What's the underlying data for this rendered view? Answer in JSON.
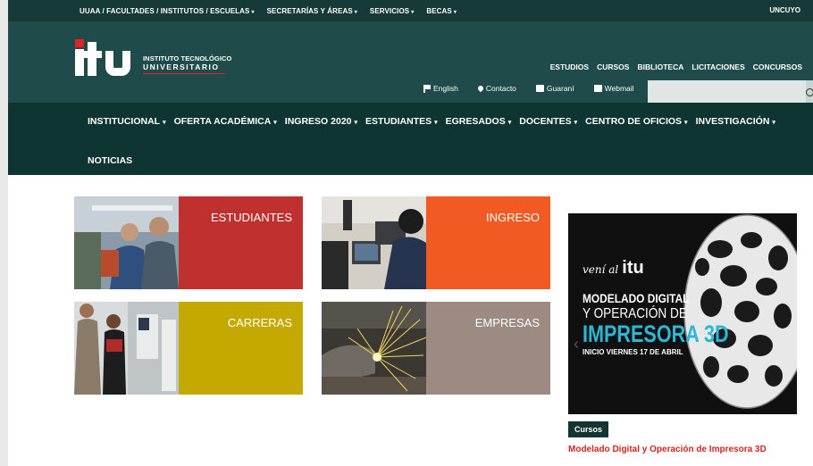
{
  "topbar": {
    "items": [
      {
        "label": "UUAA / FACULTADES / INSTITUTOS / ESCUELAS",
        "caret": "▾"
      },
      {
        "label": "SECRETARÍAS Y ÁREAS",
        "caret": "▾"
      },
      {
        "label": "SERVICIOS",
        "caret": "▾"
      },
      {
        "label": "BECAS",
        "caret": "▾"
      }
    ],
    "right_label": "UNCUYO"
  },
  "logo": {
    "line1": "INSTITUTO TECNOLÓGICO",
    "line2": "UNIVERSITARIO",
    "brand_red": "#e2232a"
  },
  "header_links": [
    "ESTUDIOS",
    "CURSOS",
    "BIBLIOTECA",
    "LICITACIONES",
    "CONCURSOS"
  ],
  "quick_links": [
    {
      "label": "English",
      "icon": "flag-icon"
    },
    {
      "label": "Contacto",
      "icon": "map-marker-icon"
    },
    {
      "label": "Guaraní",
      "icon": "edit-icon"
    },
    {
      "label": "Webmail",
      "icon": "envelope-icon"
    }
  ],
  "search": {
    "placeholder": "",
    "icon": "search-icon"
  },
  "main_nav": {
    "row1": [
      {
        "label": "INSTITUCIONAL",
        "caret": "▾"
      },
      {
        "label": "OFERTA ACADÉMICA",
        "caret": "▾"
      },
      {
        "label": "INGRESO 2020",
        "caret": "▾"
      },
      {
        "label": "ESTUDIANTES",
        "caret": "▾"
      },
      {
        "label": "EGRESADOS",
        "caret": "▾"
      },
      {
        "label": "DOCENTES",
        "caret": "▾"
      },
      {
        "label": "CENTRO DE OFICIOS",
        "caret": "▾"
      },
      {
        "label": "INVESTIGACIÓN",
        "caret": "▾"
      }
    ],
    "row2": [
      {
        "label": "NOTICIAS"
      }
    ]
  },
  "tiles": [
    {
      "label": "ESTUDIANTES",
      "color": "#c0302f"
    },
    {
      "label": "INGRESO",
      "color": "#f15a22"
    },
    {
      "label": "CARRERAS",
      "color": "#c3a900"
    },
    {
      "label": "EMPRESAS",
      "color": "#9b8b83"
    }
  ],
  "slider": {
    "veni": "vení al",
    "brand": "itu",
    "line1": "MODELADO DIGITAL",
    "line2": "Y OPERACIÓN DE",
    "line3": "IMPRESORA 3D",
    "line4": "INICIO VIERNES 17 DE ABRIL"
  },
  "news": {
    "category": "Cursos",
    "title": "Modelado Digital y Operación de Impresora 3D"
  },
  "colors": {
    "topbar": "#163a38",
    "header": "#1f4b4a",
    "mainnav": "#0f3533",
    "accent_blue": "#29b8d6",
    "news_red": "#d0261e"
  }
}
